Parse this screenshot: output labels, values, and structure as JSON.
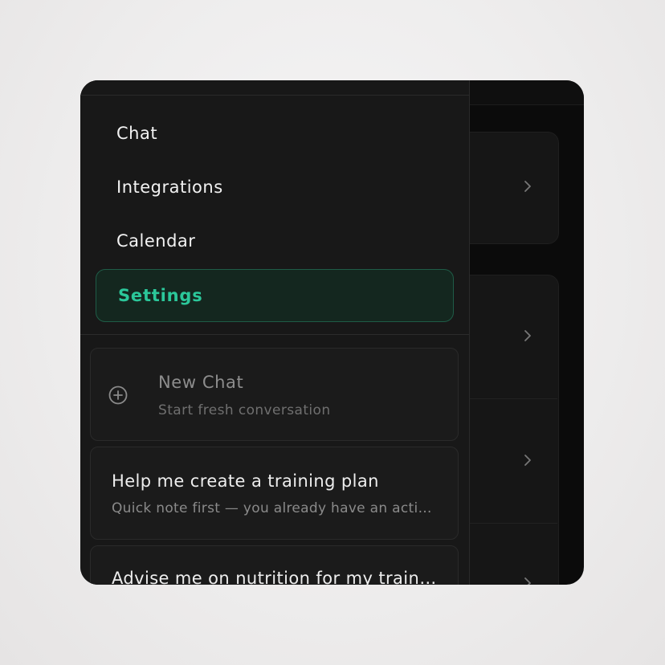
{
  "nav": {
    "items": [
      {
        "label": "Chat"
      },
      {
        "label": "Integrations"
      },
      {
        "label": "Calendar"
      },
      {
        "label": "Settings",
        "active": true
      }
    ]
  },
  "new_chat": {
    "icon": "plus-circle-icon",
    "title": "New Chat",
    "subtitle": "Start fresh conversation"
  },
  "conversations": [
    {
      "title": "Help me create a training plan",
      "preview": "Quick note first — you already have an active training plan"
    },
    {
      "title": "Advise me on nutrition for my training"
    }
  ],
  "background": {
    "row_icon": "chevron-right-icon"
  },
  "colors": {
    "accent": "#2bc79a",
    "active_bg": "#14271f",
    "active_border": "#1f5c47",
    "drawer_bg": "#181818",
    "card_bg": "#1b1b1b"
  }
}
